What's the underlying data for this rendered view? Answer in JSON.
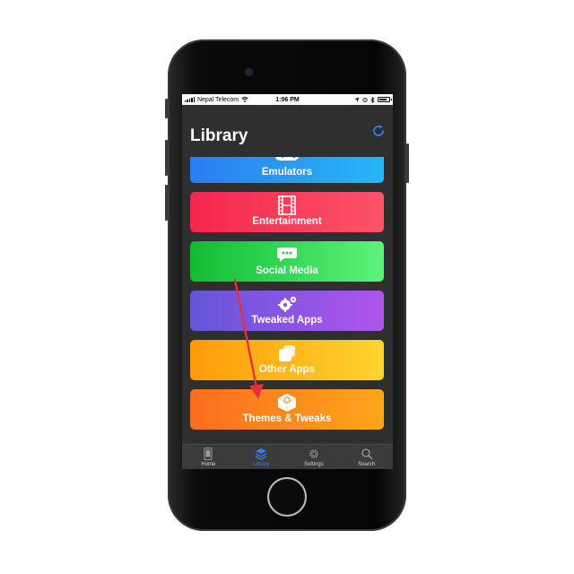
{
  "status_bar": {
    "carrier": "Nepal Telecom",
    "time": "1:06 PM"
  },
  "header": {
    "title": "Library",
    "refresh_icon": "refresh-icon"
  },
  "categories": [
    {
      "label": "Emulators",
      "icon": "gamepad-icon",
      "gradient": [
        "#2a7ef0",
        "#27b6f6"
      ]
    },
    {
      "label": "Entertainment",
      "icon": "film-icon",
      "gradient": [
        "#f5264e",
        "#fd5468"
      ]
    },
    {
      "label": "Social Media",
      "icon": "chat-bubble-icon",
      "gradient": [
        "#0fbd31",
        "#5cf37c"
      ]
    },
    {
      "label": "Tweaked Apps",
      "icon": "gears-icon",
      "gradient": [
        "#6456d8",
        "#b054ec"
      ]
    },
    {
      "label": "Other Apps",
      "icon": "stacked-squares-icon",
      "gradient": [
        "#ff9a0a",
        "#ffd42e"
      ]
    },
    {
      "label": "Themes & Tweaks",
      "icon": "theme-box-icon",
      "gradient": [
        "#fb6d1f",
        "#ffa61a"
      ]
    }
  ],
  "tab_bar": [
    {
      "label": "Home",
      "icon": "phone-icon",
      "active": false
    },
    {
      "label": "Library",
      "icon": "layers-icon",
      "active": true
    },
    {
      "label": "Settings",
      "icon": "gear-icon",
      "active": false
    },
    {
      "label": "Search",
      "icon": "search-icon",
      "active": false
    }
  ],
  "colors": {
    "accent": "#2f7ff0",
    "background": "#2f2f2f",
    "annotation_arrow": "#e8303a"
  }
}
